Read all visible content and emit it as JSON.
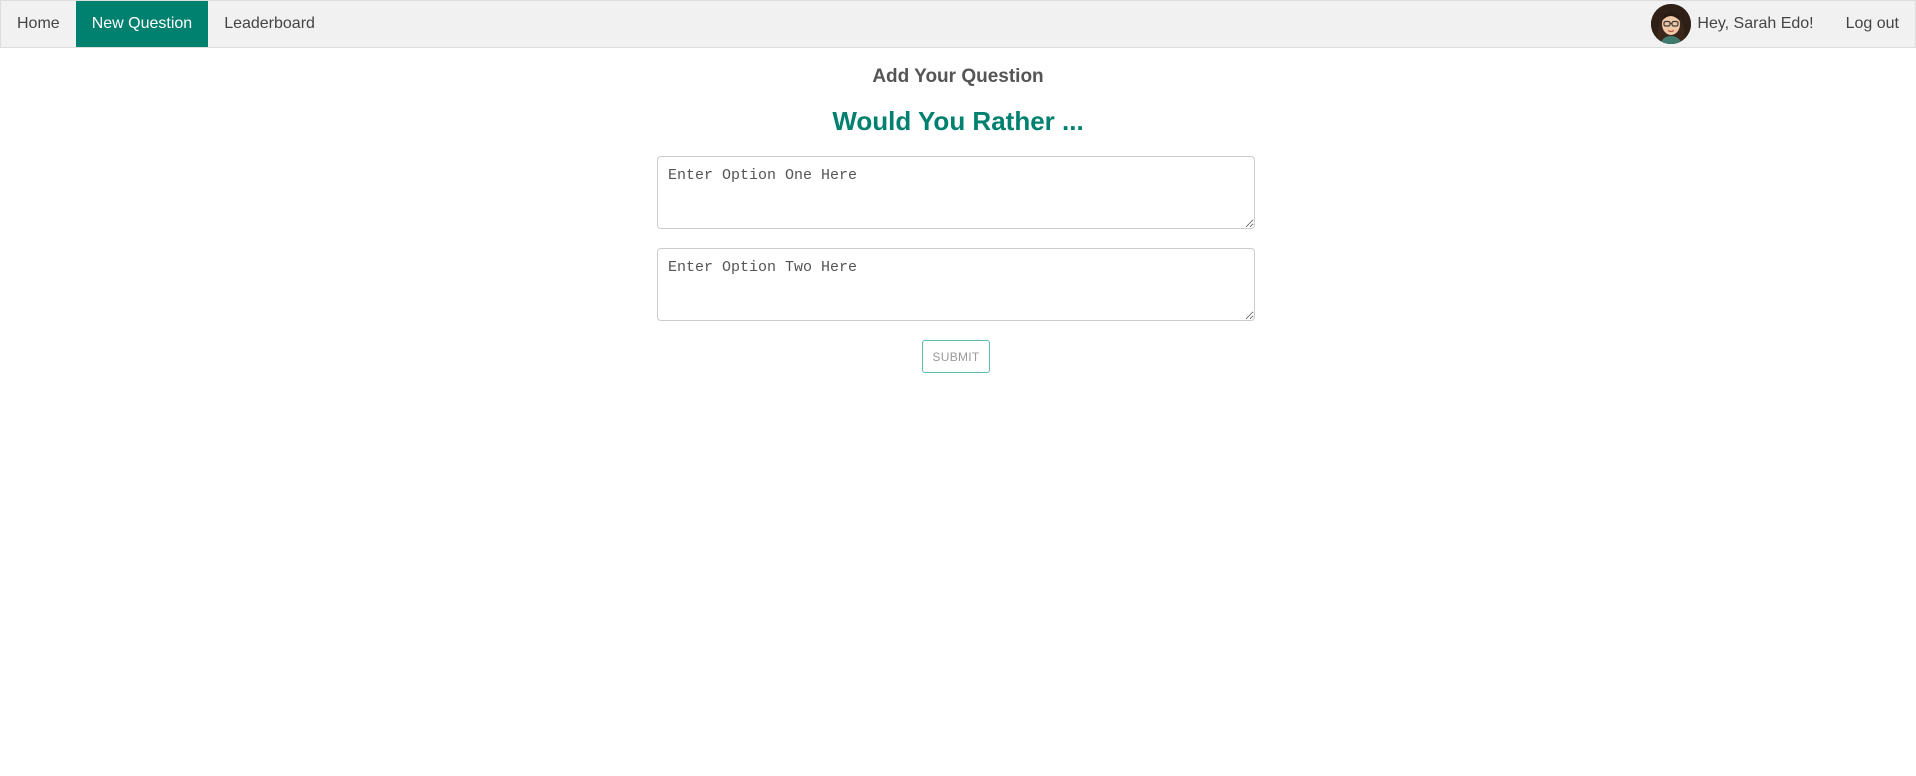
{
  "nav": {
    "items": [
      {
        "label": "Home",
        "active": false
      },
      {
        "label": "New Question",
        "active": true
      },
      {
        "label": "Leaderboard",
        "active": false
      }
    ],
    "user": {
      "greeting": "Hey, Sarah Edo!",
      "avatar_icon": "avatar-woman-glasses"
    },
    "logout_label": "Log out"
  },
  "main": {
    "heading": "Add Your Question",
    "subheading": "Would You Rather ...",
    "option_one": {
      "value": "",
      "placeholder": "Enter Option One Here"
    },
    "option_two": {
      "value": "",
      "placeholder": "Enter Option Two Here"
    },
    "submit_label": "SUBMIT"
  },
  "colors": {
    "accent": "#00806f",
    "navbar_bg": "#f1f1f1",
    "submit_border": "#5bbdb1"
  }
}
